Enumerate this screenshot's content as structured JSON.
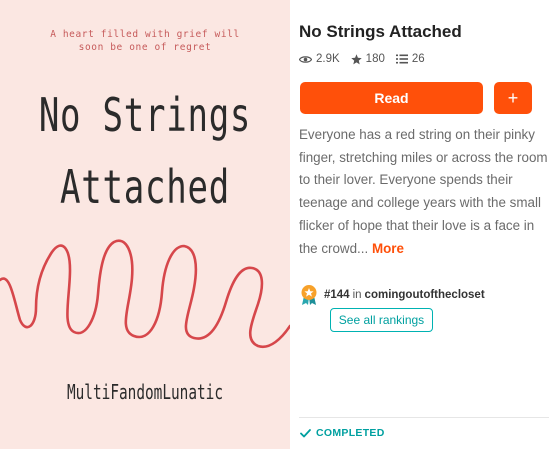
{
  "cover": {
    "tagline_line1": "A heart filled with grief will",
    "tagline_line2": "soon be one of regret",
    "title_line1": "No Strings",
    "title_line2": "Attached",
    "author": "MultiFandomLunatic"
  },
  "story": {
    "title": "No Strings Attached",
    "reads": "2.9K",
    "votes": "180",
    "parts": "26",
    "description": "Everyone has a red string on their pinky finger, stretching miles or across the room to their lover. Everyone spends their teenage and college years with the small flicker of hope that their love is a face in the crowd...",
    "more_label": "More"
  },
  "actions": {
    "read_label": "Read",
    "add_label": "+"
  },
  "ranking": {
    "rank": "#144",
    "in_label": "in",
    "tag": "comingoutofthecloset",
    "see_all_label": "See all rankings"
  },
  "status": {
    "label": "COMPLETED"
  },
  "colors": {
    "accent": "#ff500a",
    "teal": "#00a0a0",
    "cover_bg": "#fbe7e2",
    "string_red": "#d6474b"
  }
}
